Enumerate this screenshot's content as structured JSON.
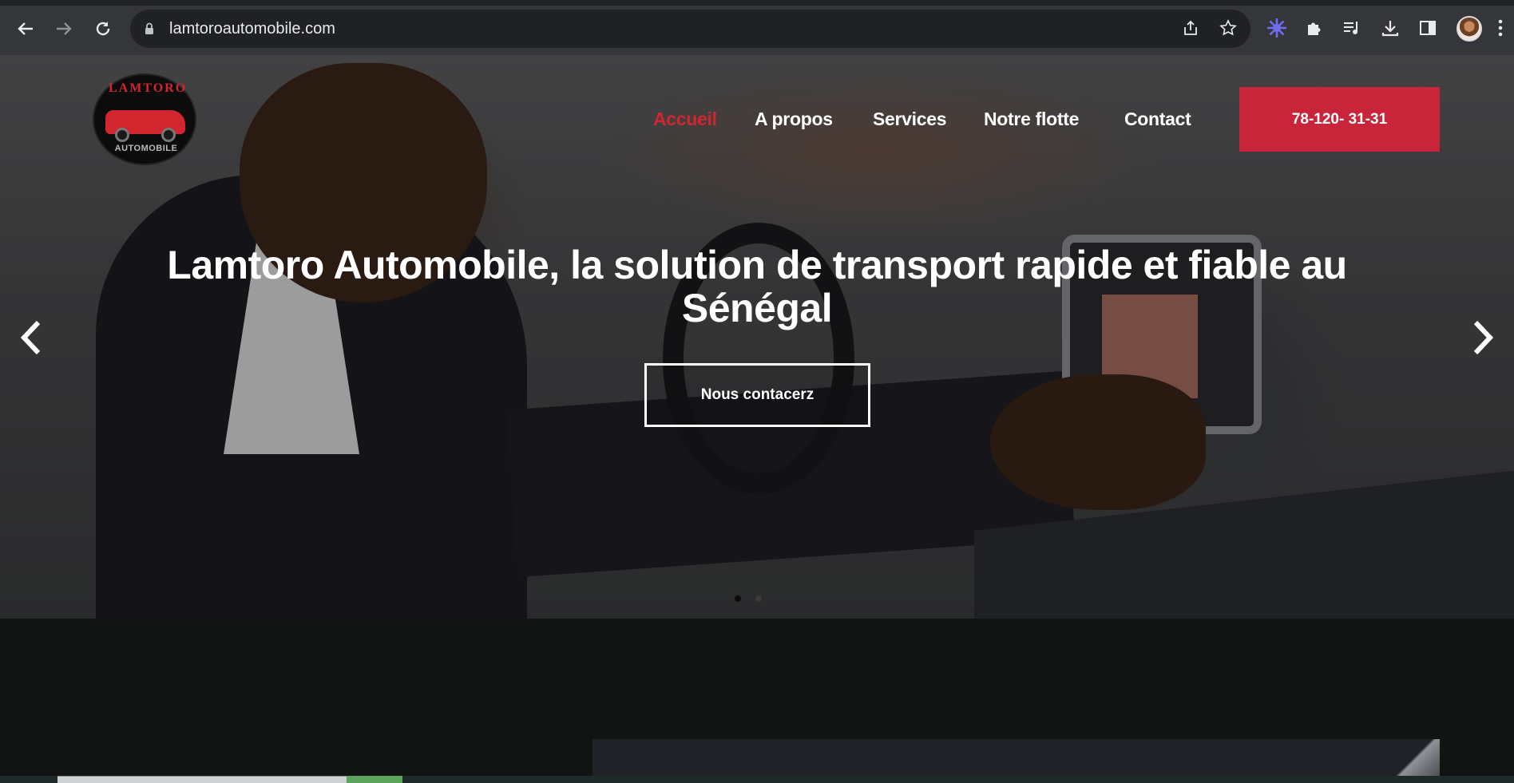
{
  "browser": {
    "url": "lamtoroautomobile.com",
    "nav_icons": [
      "back-arrow-icon",
      "forward-arrow-icon",
      "reload-icon"
    ],
    "omnibox_icons": [
      "lock-icon",
      "share-icon",
      "bookmark-star-icon"
    ],
    "toolbar_icons": [
      "extension-flower-icon",
      "puzzle-icon",
      "media-queue-icon",
      "download-icon",
      "side-panel-icon",
      "avatar",
      "kebab-menu-icon"
    ]
  },
  "site": {
    "logo": {
      "top_text": "LAMTORO",
      "bottom_text": "AUTOMOBILE"
    },
    "menu": [
      {
        "label": "Accueil",
        "active": true
      },
      {
        "label": "A propos",
        "active": false
      },
      {
        "label": "Services",
        "active": false
      },
      {
        "label": "Notre flotte",
        "active": false
      },
      {
        "label": "Contact",
        "active": false
      }
    ],
    "phone_button": "78-120- 31-31",
    "hero": {
      "headline": "Lamtoro Automobile, la solution de transport rapide et fiable au Sénégal",
      "cta": "Nous contacerz",
      "prev_arrow": "‹",
      "next_arrow": "›",
      "slides": 2,
      "active_slide": 1
    }
  },
  "colors": {
    "accent_red": "#c8243a",
    "active_menu": "#d2262f",
    "chrome_bg": "#35363a",
    "omnibox_bg": "#202124"
  }
}
